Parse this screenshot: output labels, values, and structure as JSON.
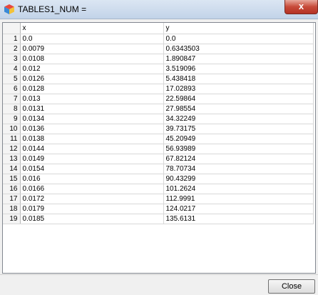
{
  "window": {
    "title": "TABLES1_NUM =",
    "close_glyph": "x"
  },
  "table": {
    "columns": [
      "x",
      "y"
    ],
    "rows": [
      {
        "n": "1",
        "x": "0.0",
        "y": "0.0"
      },
      {
        "n": "2",
        "x": "0.0079",
        "y": "0.6343503"
      },
      {
        "n": "3",
        "x": "0.0108",
        "y": "1.890847"
      },
      {
        "n": "4",
        "x": "0.012",
        "y": "3.519096"
      },
      {
        "n": "5",
        "x": "0.0126",
        "y": "5.438418"
      },
      {
        "n": "6",
        "x": "0.0128",
        "y": "17.02893"
      },
      {
        "n": "7",
        "x": "0.013",
        "y": "22.59864"
      },
      {
        "n": "8",
        "x": "0.0131",
        "y": "27.98554"
      },
      {
        "n": "9",
        "x": "0.0134",
        "y": "34.32249"
      },
      {
        "n": "10",
        "x": "0.0136",
        "y": "39.73175"
      },
      {
        "n": "11",
        "x": "0.0138",
        "y": "45.20949"
      },
      {
        "n": "12",
        "x": "0.0144",
        "y": "56.93989"
      },
      {
        "n": "13",
        "x": "0.0149",
        "y": "67.82124"
      },
      {
        "n": "14",
        "x": "0.0154",
        "y": "78.70734"
      },
      {
        "n": "15",
        "x": "0.016",
        "y": "90.43299"
      },
      {
        "n": "16",
        "x": "0.0166",
        "y": "101.2624"
      },
      {
        "n": "17",
        "x": "0.0172",
        "y": "112.9991"
      },
      {
        "n": "18",
        "x": "0.0179",
        "y": "124.0217"
      },
      {
        "n": "19",
        "x": "0.0185",
        "y": "135.6131"
      }
    ]
  },
  "footer": {
    "close_label": "Close"
  },
  "icons": {
    "app": "app-cube-icon"
  },
  "colors": {
    "titlebar": "#c9d8ec",
    "close_red": "#c74a39",
    "grid_line": "#d8d8d8"
  }
}
